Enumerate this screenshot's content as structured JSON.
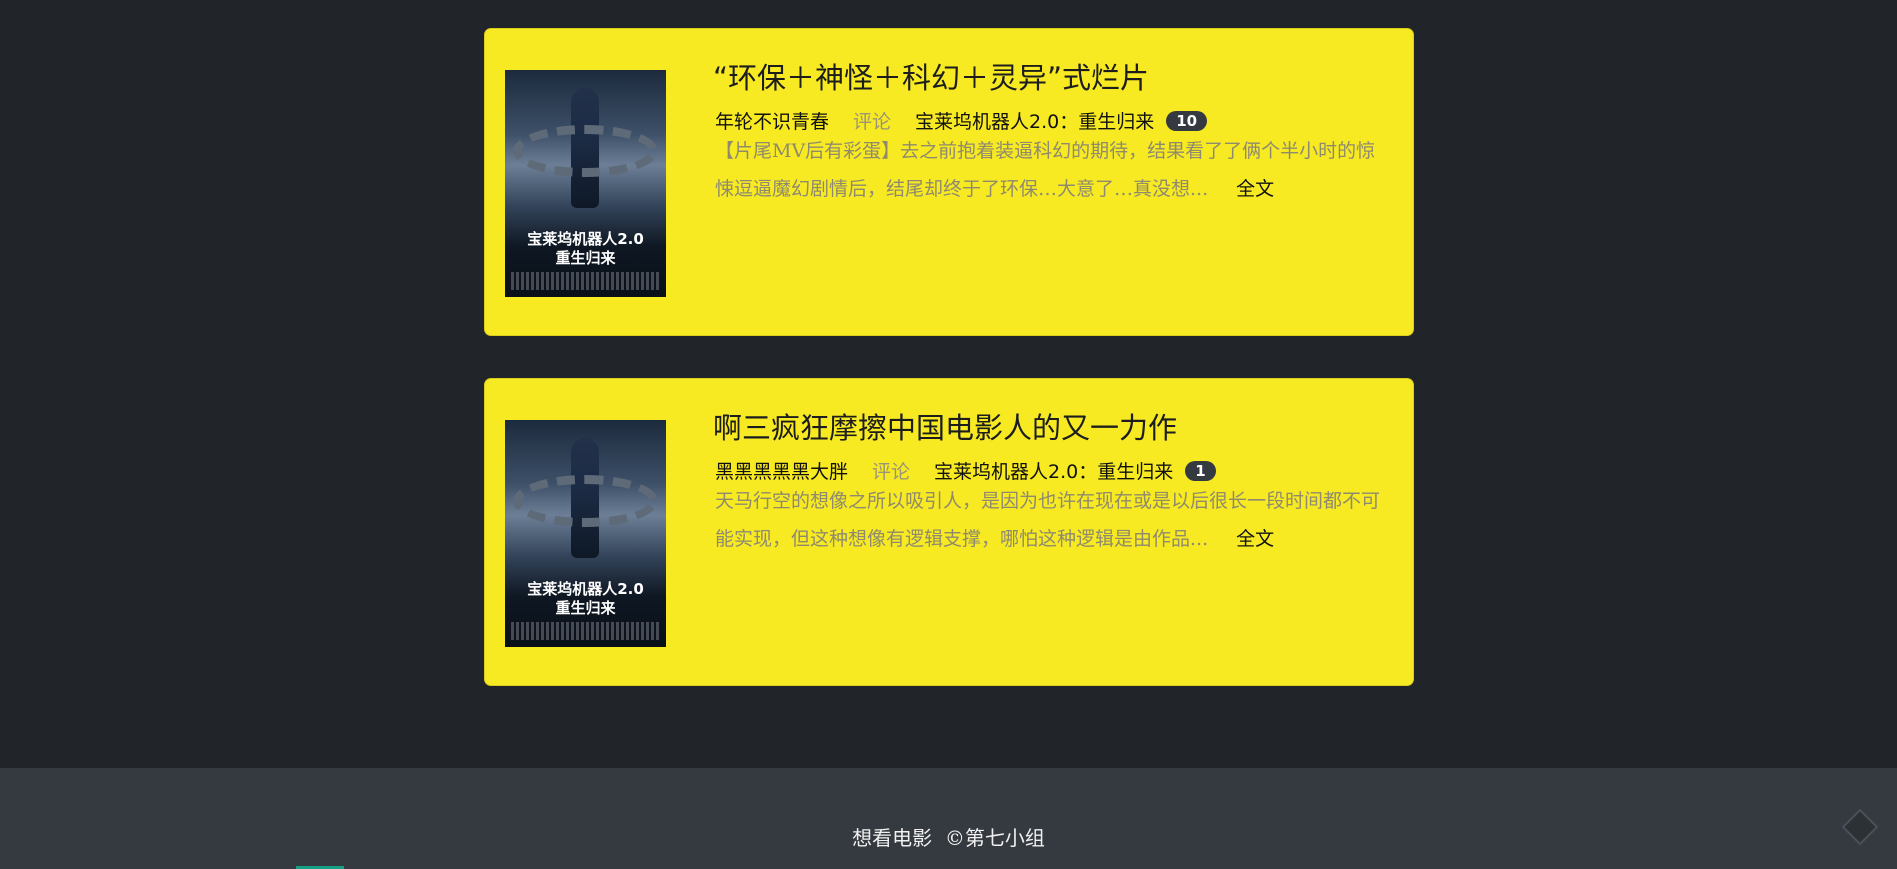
{
  "reviews": [
    {
      "title": "“环保＋神怪＋科幻＋灵异”式烂片",
      "author": "年轮不识青春",
      "type": "评论",
      "movie": "宝莱坞机器人2.0：重生归来",
      "count": "10",
      "excerpt": "【片尾MV后有彩蛋】去之前抱着装逼科幻的期待，结果看了了俩个半小时的惊悚逗逼魔幻剧情后，结尾却终于了环保…大意了…真没想...",
      "link": "全文",
      "poster_title": "宝莱坞机器人2.0\n重生归来"
    },
    {
      "title": "啊三疯狂摩擦中国电影人的又一力作",
      "author": "黑黑黑黑黑大胖",
      "type": "评论",
      "movie": "宝莱坞机器人2.0：重生归来",
      "count": "1",
      "excerpt": "天马行空的想像之所以吸引人，是因为也许在现在或是以后很长一段时间都不可能实现，但这种想像有逻辑支撑，哪怕这种逻辑是由作品...",
      "link": "全文",
      "poster_title": "宝莱坞机器人2.0\n重生归来"
    }
  ],
  "footer": {
    "text": "想看电影  ©第七小组",
    "scroll_icon": "scroll-top-icon"
  },
  "colors": {
    "background": "#212429",
    "card": "#f7ea23",
    "footer": "#343a40",
    "badge": "#343a40"
  }
}
